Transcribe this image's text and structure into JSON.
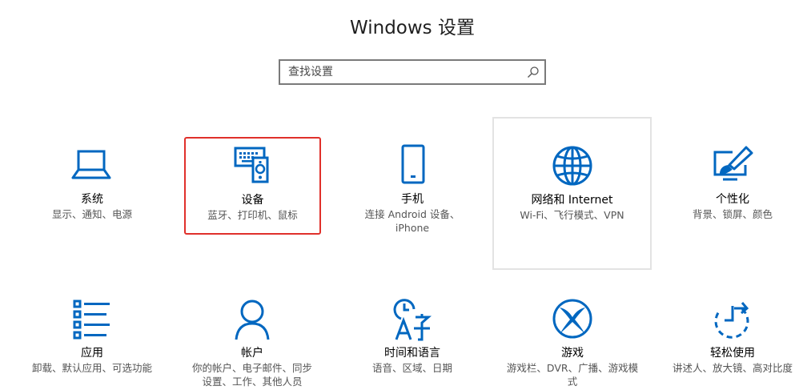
{
  "window": {
    "title": "Windows 设置"
  },
  "search": {
    "placeholder": "查找设置"
  },
  "tiles": [
    {
      "name": "系统",
      "desc": "显示、通知、电源",
      "icon": "laptop-icon"
    },
    {
      "name": "设备",
      "desc": "蓝牙、打印机、鼠标",
      "icon": "devices-icon"
    },
    {
      "name": "手机",
      "desc": "连接 Android 设备、iPhone",
      "icon": "phone-icon"
    },
    {
      "name": "网络和 Internet",
      "desc": "Wi-Fi、飞行模式、VPN",
      "icon": "globe-icon"
    },
    {
      "name": "个性化",
      "desc": "背景、锁屏、颜色",
      "icon": "personalization-icon"
    },
    {
      "name": "应用",
      "desc": "卸载、默认应用、可选功能",
      "icon": "apps-icon"
    },
    {
      "name": "帐户",
      "desc": "你的帐户、电子邮件、同步设置、工作、其他人员",
      "icon": "account-icon"
    },
    {
      "name": "时间和语言",
      "desc": "语音、区域、日期",
      "icon": "time-language-icon"
    },
    {
      "name": "游戏",
      "desc": "游戏栏、DVR、广播、游戏模式",
      "icon": "xbox-icon"
    },
    {
      "name": "轻松使用",
      "desc": "讲述人、放大镜、高对比度",
      "icon": "ease-of-access-icon"
    }
  ],
  "colors": {
    "accent": "#0067c0",
    "selection": "#e0302b"
  }
}
